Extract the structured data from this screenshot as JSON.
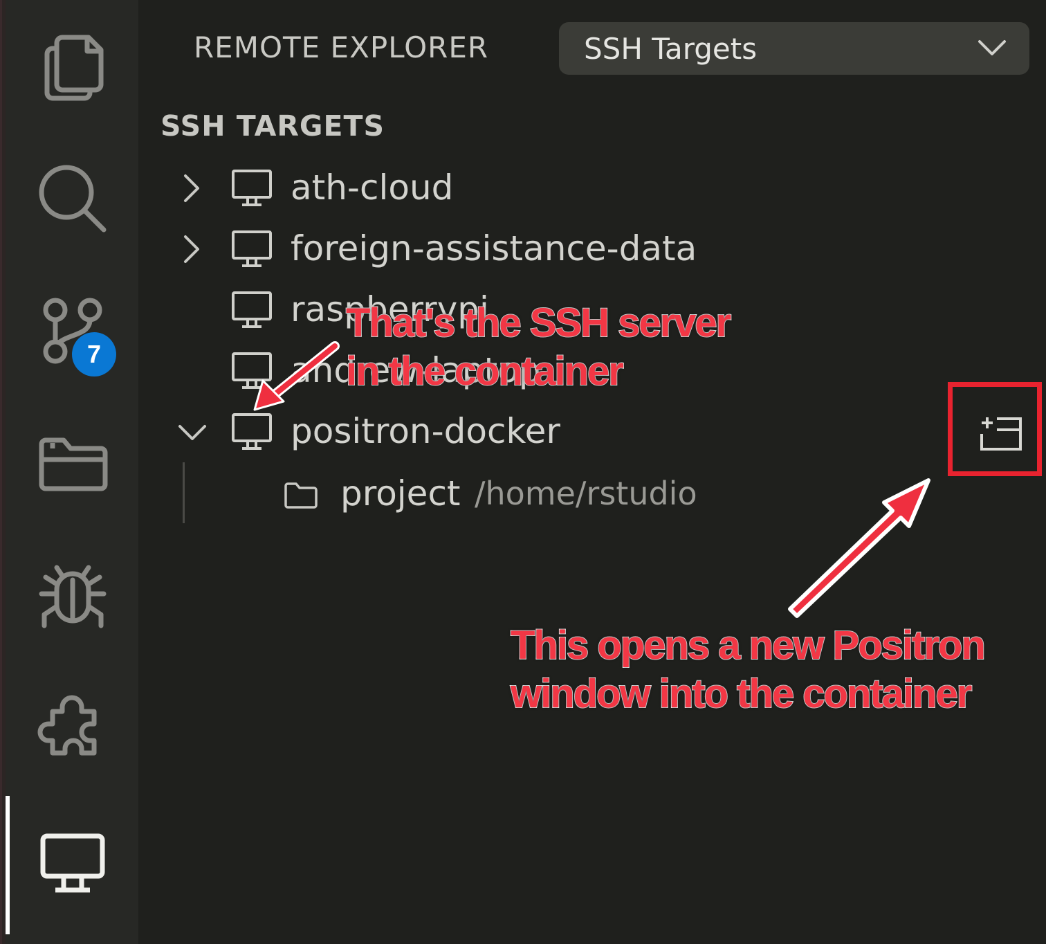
{
  "activity_bar": {
    "items": [
      {
        "icon": "files-icon"
      },
      {
        "icon": "search-icon"
      },
      {
        "icon": "source-control-icon",
        "badge": "7"
      },
      {
        "icon": "folder-icon"
      },
      {
        "icon": "debug-icon"
      },
      {
        "icon": "extensions-icon"
      },
      {
        "icon": "remote-explorer-icon",
        "active": true
      }
    ]
  },
  "sidebar": {
    "title": "REMOTE EXPLORER",
    "dropdown_value": "SSH Targets",
    "section_title": "SSH TARGETS",
    "targets": [
      {
        "label": "ath-cloud",
        "expandable": true,
        "expanded": false
      },
      {
        "label": "foreign-assistance-data",
        "expandable": true,
        "expanded": false
      },
      {
        "label": "raspberrypi",
        "expandable": false,
        "expanded": false
      },
      {
        "label": "andrew-laptop",
        "expandable": false,
        "expanded": false
      },
      {
        "label": "positron-docker",
        "expandable": true,
        "expanded": true
      }
    ],
    "project": {
      "label": "project",
      "path": "/home/rstudio"
    }
  },
  "annotations": {
    "ssh_server_line1": "That's the SSH server",
    "ssh_server_line2": "in the container",
    "new_window_line1": "This opens a new Positron",
    "new_window_line2": "window into the container"
  },
  "colors": {
    "annotation": "#f23745",
    "highlight_box": "#e8232f",
    "badge": "#0a78d4"
  }
}
